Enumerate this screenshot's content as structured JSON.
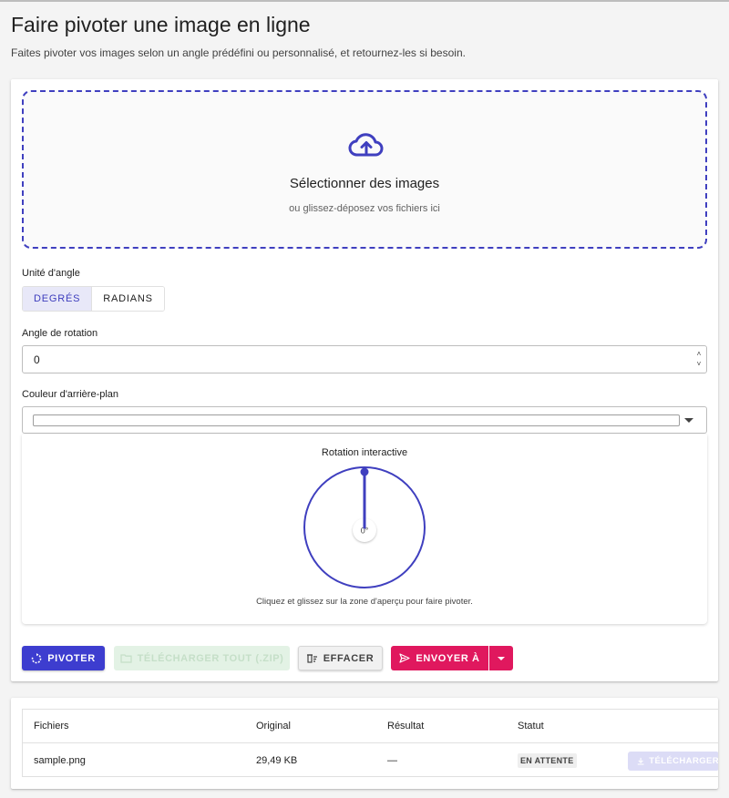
{
  "page": {
    "title": "Faire pivoter une image en ligne",
    "subtitle": "Faites pivoter vos images selon un angle prédéfini ou personnalisé, et retournez-les si besoin."
  },
  "dropzone": {
    "title": "Sélectionner des images",
    "subtitle": "ou glissez-déposez vos fichiers ici",
    "icon": "cloud-upload-icon"
  },
  "angle_unit": {
    "label": "Unité d'angle",
    "options": [
      "DEGRÉS",
      "RADIANS"
    ],
    "selected": "DEGRÉS"
  },
  "rotation_angle": {
    "label": "Angle de rotation",
    "value": "0"
  },
  "background_color": {
    "label": "Couleur d'arrière-plan",
    "value": "#ffffff"
  },
  "interactive_rotation": {
    "title": "Rotation interactive",
    "angle_display": "0°",
    "angle_value": 0,
    "hint": "Cliquez et glissez sur la zone d'aperçu pour faire pivoter."
  },
  "actions": {
    "rotate": "PIVOTER",
    "download_all": "TÉLÉCHARGER TOUT (.ZIP)",
    "clear": "EFFACER",
    "send_to": "ENVOYER À"
  },
  "files_table": {
    "headers": [
      "Fichiers",
      "Original",
      "Résultat",
      "Statut"
    ],
    "rows": [
      {
        "name": "sample.png",
        "original": "29,49 KB",
        "result": "—",
        "status": "EN ATTENTE",
        "download": "TÉLÉCHARGER"
      }
    ]
  },
  "colors": {
    "primary": "#3d3dcf",
    "send": "#e0185e",
    "dial": "#3f3fbf"
  }
}
